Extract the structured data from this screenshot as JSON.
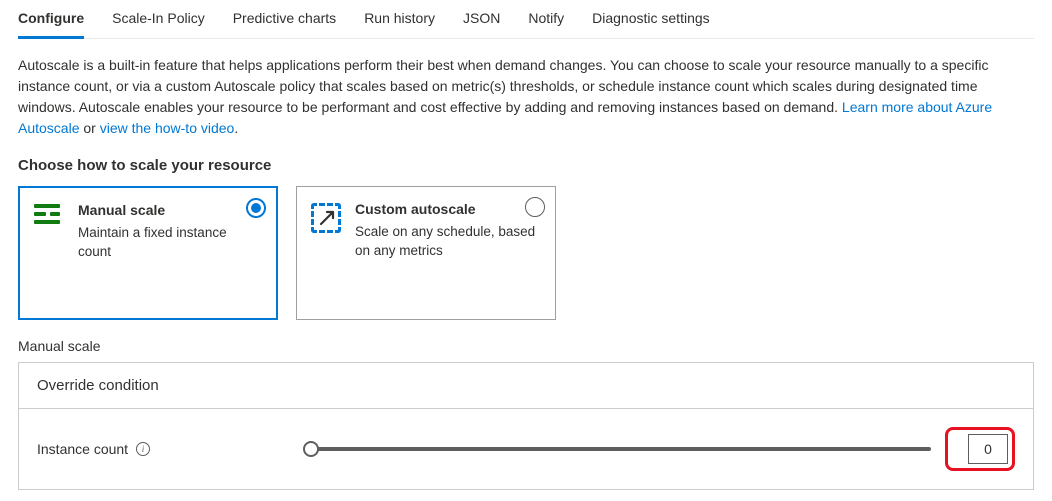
{
  "tabs": [
    {
      "label": "Configure",
      "active": true
    },
    {
      "label": "Scale-In Policy",
      "active": false
    },
    {
      "label": "Predictive charts",
      "active": false
    },
    {
      "label": "Run history",
      "active": false
    },
    {
      "label": "JSON",
      "active": false
    },
    {
      "label": "Notify",
      "active": false
    },
    {
      "label": "Diagnostic settings",
      "active": false
    }
  ],
  "description": {
    "text_before": "Autoscale is a built-in feature that helps applications perform their best when demand changes. You can choose to scale your resource manually to a specific instance count, or via a custom Autoscale policy that scales based on metric(s) thresholds, or schedule instance count which scales during designated time windows. Autoscale enables your resource to be performant and cost effective by adding and removing instances based on demand. ",
    "link1": "Learn more about Azure Autoscale",
    "middle": " or ",
    "link2": "view the how-to video",
    "after": "."
  },
  "choose_heading": "Choose how to scale your resource",
  "cards": {
    "manual": {
      "title": "Manual scale",
      "desc": "Maintain a fixed instance count"
    },
    "custom": {
      "title": "Custom autoscale",
      "desc": "Scale on any schedule, based on any metrics"
    }
  },
  "subsection": "Manual scale",
  "panel": {
    "header": "Override condition",
    "instance_label": "Instance count",
    "instance_value": "0"
  }
}
